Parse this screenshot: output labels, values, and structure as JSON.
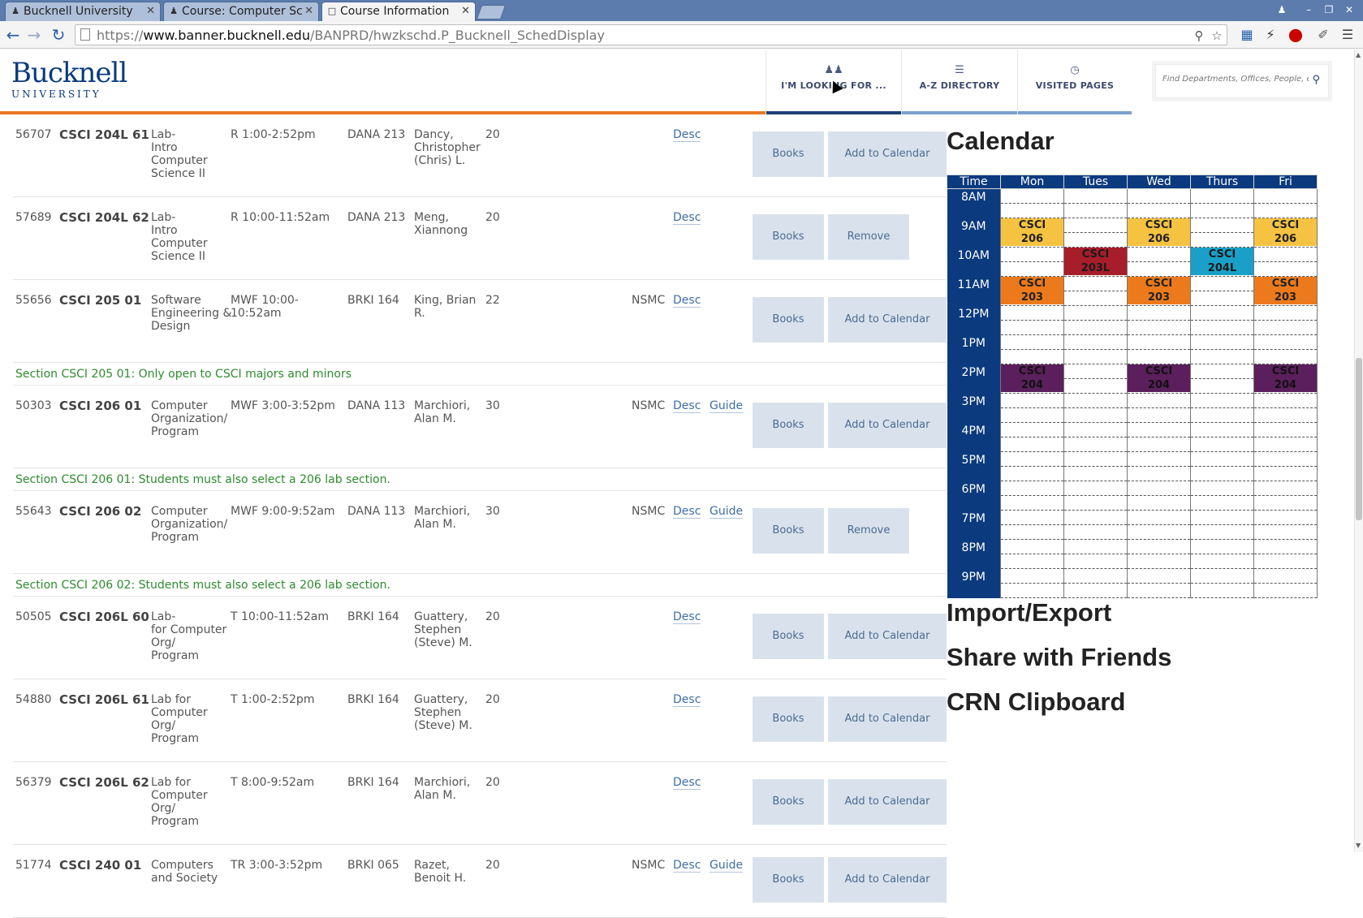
{
  "browser": {
    "tabs": [
      {
        "label": "Bucknell University"
      },
      {
        "label": "Course: Computer Sc"
      },
      {
        "label": "Course Information"
      }
    ],
    "url_prefix": "https://",
    "url_host": "www.banner.bucknell.edu",
    "url_path": "/BANPRD/hwzkschd.P_Bucknell_SchedDisplay"
  },
  "site": {
    "logo_line1": "Bucknell",
    "logo_line2": "UNIVERSITY",
    "nav": [
      {
        "label": "I'M LOOKING FOR ...",
        "icon": "people-icon"
      },
      {
        "label": "A-Z DIRECTORY",
        "icon": "list-icon"
      },
      {
        "label": "VISITED PAGES",
        "icon": "clock-icon"
      }
    ],
    "search_placeholder": "Find Departments, Offices, People, etc."
  },
  "courses": [
    {
      "crn": "56707",
      "code": "CSCI 204L 61",
      "title": [
        "Lab-",
        "Intro",
        "Computer",
        "Science II"
      ],
      "time": "R 1:00-2:52pm",
      "room": "DANA 213",
      "instructor": [
        "Dancy,",
        "Christopher",
        "(Chris) L."
      ],
      "cap": "20",
      "attr": "",
      "desc": "Desc",
      "guide": "",
      "books": "Books",
      "action": "Add to Calendar"
    },
    {
      "crn": "57689",
      "code": "CSCI 204L 62",
      "title": [
        "Lab-",
        "Intro",
        "Computer",
        "Science II"
      ],
      "time": "R 10:00-11:52am",
      "room": "DANA 213",
      "instructor": [
        "Meng,",
        "Xiannong"
      ],
      "cap": "20",
      "attr": "",
      "desc": "Desc",
      "guide": "",
      "books": "Books",
      "action": "Remove"
    },
    {
      "crn": "55656",
      "code": "CSCI 205 01",
      "title": [
        "Software",
        "Engineering &",
        "Design"
      ],
      "time": "MWF 10:00-10:52am",
      "room": "BRKI 164",
      "instructor": [
        "King, Brian",
        "R."
      ],
      "cap": "22",
      "attr": "NSMC",
      "desc": "Desc",
      "guide": "",
      "books": "Books",
      "action": "Add to Calendar",
      "note": "Section CSCI 205 01: Only open to CSCI majors and minors"
    },
    {
      "crn": "50303",
      "code": "CSCI 206 01",
      "title": [
        "Computer",
        "Organization/",
        "Program"
      ],
      "time": "MWF 3:00-3:52pm",
      "room": "DANA 113",
      "instructor": [
        "Marchiori,",
        "Alan M."
      ],
      "cap": "30",
      "attr": "NSMC",
      "desc": "Desc",
      "guide": "Guide",
      "books": "Books",
      "action": "Add to Calendar",
      "note": "Section CSCI 206 01: Students must also select a 206 lab section."
    },
    {
      "crn": "55643",
      "code": "CSCI 206 02",
      "title": [
        "Computer",
        "Organization/",
        "Program"
      ],
      "time": "MWF 9:00-9:52am",
      "room": "DANA 113",
      "instructor": [
        "Marchiori,",
        "Alan M."
      ],
      "cap": "30",
      "attr": "NSMC",
      "desc": "Desc",
      "guide": "Guide",
      "books": "Books",
      "action": "Remove",
      "note": "Section CSCI 206 02: Students must also select a 206 lab section."
    },
    {
      "crn": "50505",
      "code": "CSCI 206L 60",
      "title": [
        "Lab-",
        "for Computer",
        "Org/",
        "Program"
      ],
      "time": "T 10:00-11:52am",
      "room": "BRKI 164",
      "instructor": [
        "Guattery,",
        "Stephen",
        "(Steve) M."
      ],
      "cap": "20",
      "attr": "",
      "desc": "Desc",
      "guide": "",
      "books": "Books",
      "action": "Add to Calendar"
    },
    {
      "crn": "54880",
      "code": "CSCI 206L 61",
      "title": [
        "Lab for",
        "Computer",
        "Org/",
        "Program"
      ],
      "time": "T 1:00-2:52pm",
      "room": "BRKI 164",
      "instructor": [
        "Guattery,",
        "Stephen",
        "(Steve) M."
      ],
      "cap": "20",
      "attr": "",
      "desc": "Desc",
      "guide": "",
      "books": "Books",
      "action": "Add to Calendar"
    },
    {
      "crn": "56379",
      "code": "CSCI 206L 62",
      "title": [
        "Lab for",
        "Computer",
        "Org/",
        "Program"
      ],
      "time": "T 8:00-9:52am",
      "room": "BRKI 164",
      "instructor": [
        "Marchiori,",
        "Alan M."
      ],
      "cap": "20",
      "attr": "",
      "desc": "Desc",
      "guide": "",
      "books": "Books",
      "action": "Add to Calendar"
    },
    {
      "crn": "51774",
      "code": "CSCI 240 01",
      "title": [
        "Computers",
        "and Society"
      ],
      "time": "TR 3:00-3:52pm",
      "room": "BRKI 065",
      "instructor": [
        "Razet,",
        "Benoit H."
      ],
      "cap": "20",
      "attr": "NSMC",
      "desc": "Desc",
      "guide": "Guide",
      "books": "Books",
      "action": "Add to Calendar"
    }
  ],
  "calendar": {
    "title": "Calendar",
    "headers": [
      "Time",
      "Mon",
      "Tues",
      "Wed",
      "Thurs",
      "Fri"
    ],
    "hours": [
      "8AM",
      "9AM",
      "10AM",
      "11AM",
      "12PM",
      "1PM",
      "2PM",
      "3PM",
      "4PM",
      "5PM",
      "6PM",
      "7PM",
      "8PM",
      "9PM"
    ],
    "events": [
      {
        "label": [
          "CSCI",
          "206"
        ],
        "day": 1,
        "hour": 1,
        "color": "#f5c242",
        "text": "#222"
      },
      {
        "label": [
          "CSCI",
          "206"
        ],
        "day": 3,
        "hour": 1,
        "color": "#f5c242",
        "text": "#222"
      },
      {
        "label": [
          "CSCI",
          "206"
        ],
        "day": 5,
        "hour": 1,
        "color": "#f5c242",
        "text": "#222"
      },
      {
        "label": [
          "CSCI",
          "203L"
        ],
        "day": 2,
        "hour": 2,
        "color": "#a71d2a",
        "text": "#1a1a1a"
      },
      {
        "label": [
          "CSCI",
          "204L"
        ],
        "day": 4,
        "hour": 2,
        "color": "#1aa0c8",
        "text": "#1a1a1a"
      },
      {
        "label": [
          "CSCI",
          "203"
        ],
        "day": 1,
        "hour": 3,
        "color": "#ec7a1c",
        "text": "#222"
      },
      {
        "label": [
          "CSCI",
          "203"
        ],
        "day": 3,
        "hour": 3,
        "color": "#ec7a1c",
        "text": "#222"
      },
      {
        "label": [
          "CSCI",
          "203"
        ],
        "day": 5,
        "hour": 3,
        "color": "#ec7a1c",
        "text": "#222"
      },
      {
        "label": [
          "CSCI",
          "204"
        ],
        "day": 1,
        "hour": 6,
        "color": "#5a1f5c",
        "text": "#111"
      },
      {
        "label": [
          "CSCI",
          "204"
        ],
        "day": 3,
        "hour": 6,
        "color": "#5a1f5c",
        "text": "#111"
      },
      {
        "label": [
          "CSCI",
          "204"
        ],
        "day": 5,
        "hour": 6,
        "color": "#5a1f5c",
        "text": "#111"
      }
    ]
  },
  "sections": {
    "import_export": "Import/Export",
    "share": "Share with Friends",
    "clipboard": "CRN Clipboard"
  }
}
